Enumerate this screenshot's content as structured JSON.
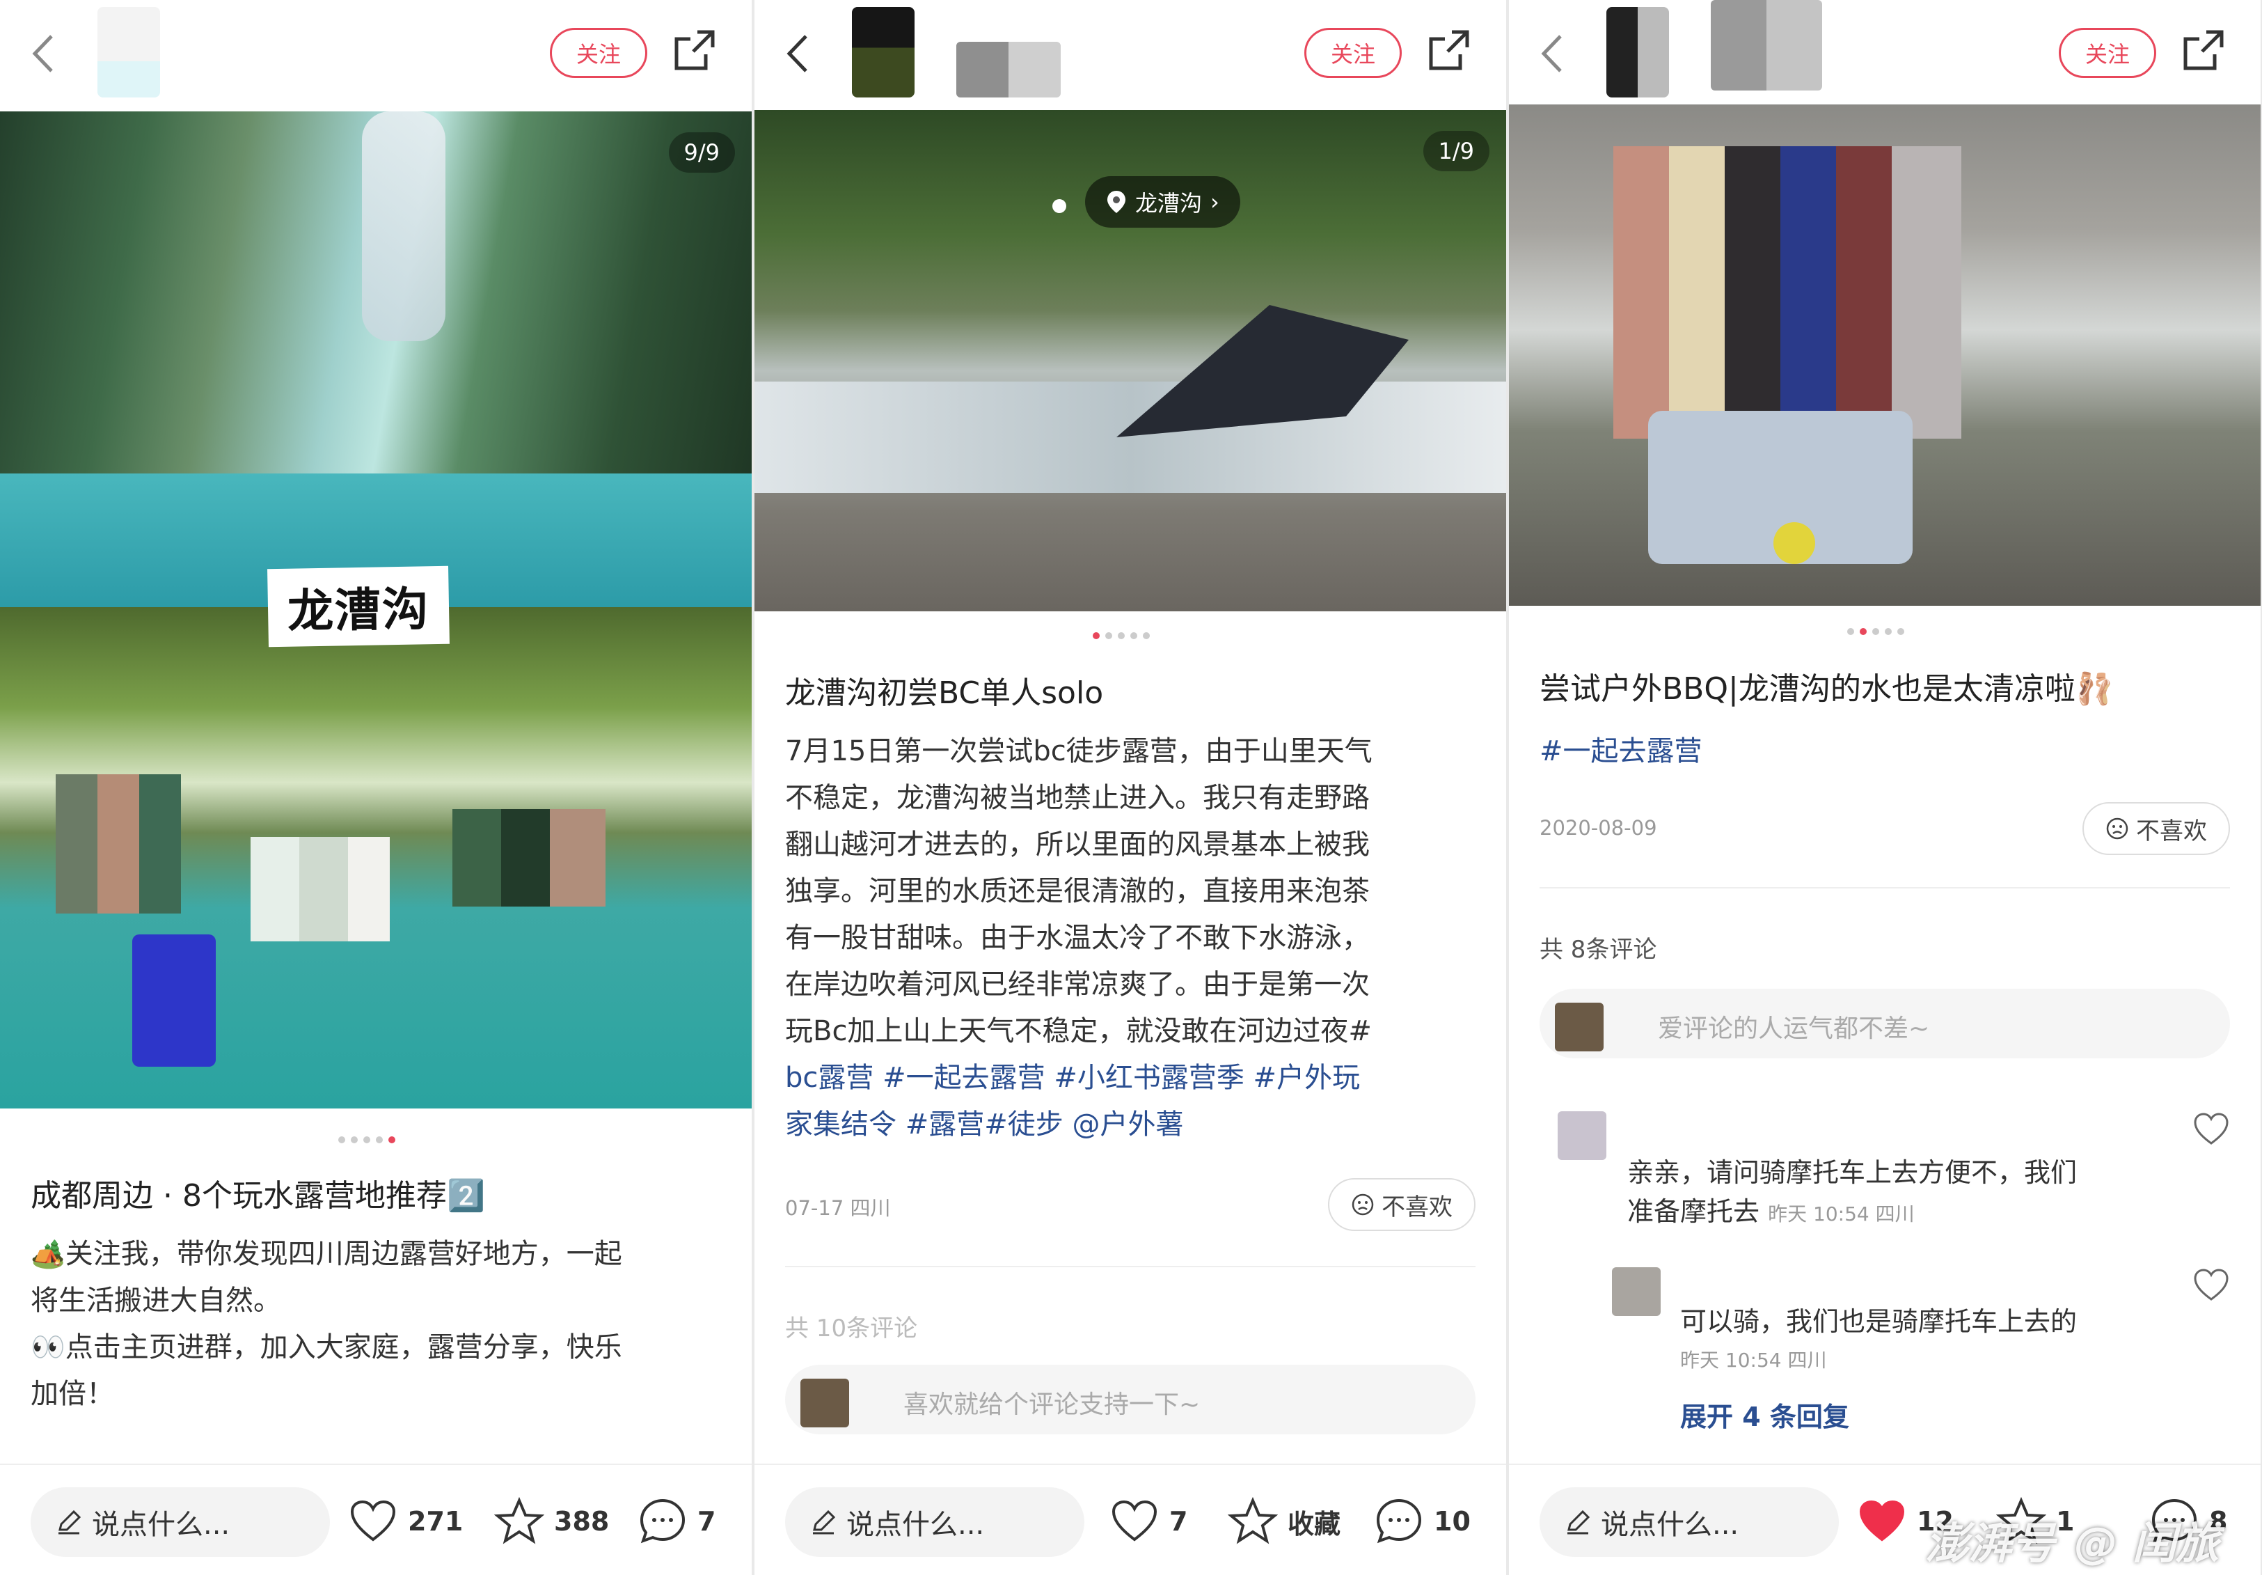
{
  "panels": [
    {
      "follow_label": "关注",
      "image_counter": "9/9",
      "overlay_title": "龙漕沟",
      "title": "成都周边 · 8个玩水露营地推荐2️⃣",
      "desc_lines": [
        "🏕️关注我，带你发现四川周边露营好地方，一起",
        "将生活搬进大自然。",
        "👀点击主页进群，加入大家庭，露营分享，快乐",
        "加倍！"
      ],
      "input_placeholder": "说点什么...",
      "likes": "271",
      "stars": "388",
      "comments": "7"
    },
    {
      "follow_label": "关注",
      "image_counter": "1/9",
      "location": "龙漕沟",
      "title": "龙漕沟初尝BC单人solo",
      "desc_lines": [
        "7月15日第一次尝试bc徒步露营，由于山里天气",
        "不稳定，龙漕沟被当地禁止进入。我只有走野路",
        "翻山越河才进去的，所以里面的风景基本上被我",
        "独享。河里的水质还是很清澈的，直接用来泡茶",
        "有一股甘甜味。由于水温太冷了不敢下水游泳，",
        "在岸边吹着河风已经非常凉爽了。由于是第一次",
        "玩Bc加上山上天气不稳定，就没敢在河边过夜#"
      ],
      "tag_lines": [
        "bc露营 #一起去露营 #小红书露营季 #户外玩",
        "家集结令 #露营#徒步 @户外薯"
      ],
      "date": "07-17 四川",
      "dislike_label": "不喜欢",
      "comment_count": "共 10条评论",
      "comment_placeholder": "喜欢就给个评论支持一下~",
      "input_placeholder": "说点什么...",
      "likes": "7",
      "stars": "收藏",
      "comments": "10"
    },
    {
      "follow_label": "关注",
      "title": "尝试户外BBQ|龙漕沟的水也是太清凉啦🩰",
      "tag": "#一起去露营",
      "date": "2020-08-09",
      "dislike_label": "不喜欢",
      "comment_count": "共 8条评论",
      "comment_placeholder": "爱评论的人运气都不差~",
      "comment1_text_a": "亲亲，请问骑摩托车上去方便不，我们",
      "comment1_text_b": "准备摩托去",
      "comment1_meta": "昨天 10:54 四川",
      "reply1_text": "可以骑，我们也是骑摩托车上去的",
      "reply1_meta": "昨天 10:54 四川",
      "expand_label": "展开 4 条回复",
      "input_placeholder": "说点什么...",
      "likes": "12",
      "stars": "1",
      "comments": "8"
    }
  ],
  "watermark": [
    "澎湃号",
    "@ 闰旅"
  ],
  "colors": {
    "accent": "#e8475b",
    "tag": "#2a4e91"
  },
  "icons": [
    "back-icon",
    "share-icon",
    "location-pin-icon",
    "heart-icon",
    "star-icon",
    "comment-icon",
    "pencil-icon",
    "sad-face-icon"
  ]
}
